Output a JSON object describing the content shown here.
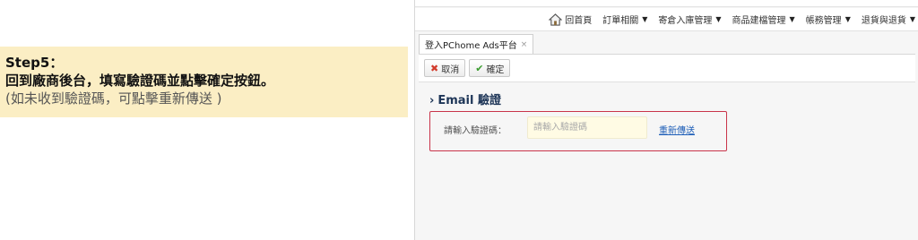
{
  "instruction": {
    "step": "Step5：",
    "line1": "回到廠商後台，填寫驗證碼並點擊確定按鈕。",
    "line2": "(如未收到驗證碼，可點擊重新傳送 )"
  },
  "menu": {
    "home": "回首頁",
    "items": [
      "訂單相關",
      "寄倉入庫管理",
      "商品建檔管理",
      "帳務管理",
      "退貨與退貨"
    ]
  },
  "tab": {
    "label": "登入PChome Ads平台",
    "close": "×"
  },
  "toolbar": {
    "cancel_label": "取消",
    "confirm_label": "確定"
  },
  "section": {
    "title": "Email 驗證"
  },
  "form": {
    "field_label": "請輸入驗證碼：",
    "input_value": "",
    "input_placeholder": "請輸入驗證碼",
    "resend_label": "重新傳送"
  }
}
